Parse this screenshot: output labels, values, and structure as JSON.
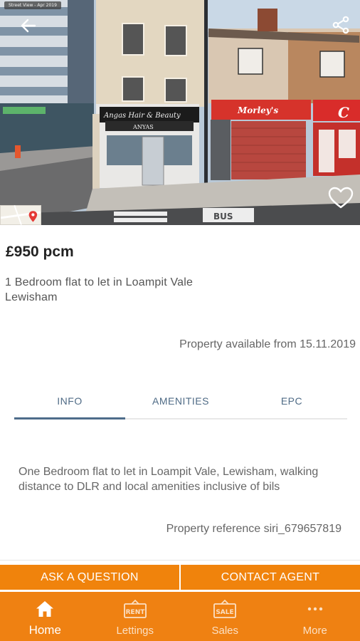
{
  "hero": {
    "streetview_badge": "Street View - Apr 2019",
    "shop_signs": {
      "salon": "Angas Hair & Beauty",
      "salon_name": "ANYAS",
      "takeaway": "Morley's",
      "right_shop": "C"
    },
    "road_marking": "BUS"
  },
  "listing": {
    "price": "£950 pcm",
    "title": "1 Bedroom flat to let in Loampit Vale Lewisham",
    "available": "Property available from 15.11.2019"
  },
  "tabs": [
    {
      "label": "INFO",
      "active": true
    },
    {
      "label": "AMENITIES",
      "active": false
    },
    {
      "label": "EPC",
      "active": false
    }
  ],
  "info": {
    "description": "One Bedroom flat to let in Loampit Vale, Lewisham, walking distance to DLR and local amenities inclusive of bils",
    "reference": "Property reference siri_679657819"
  },
  "actions": {
    "ask": "ASK A QUESTION",
    "contact": "CONTACT AGENT"
  },
  "nav": {
    "items": [
      {
        "label": "Home",
        "icon": "home-icon",
        "badge": ""
      },
      {
        "label": "Lettings",
        "icon": "rent-sign-icon",
        "badge": "RENT"
      },
      {
        "label": "Sales",
        "icon": "sale-sign-icon",
        "badge": "SALE"
      },
      {
        "label": "More",
        "icon": "more-dots-icon",
        "badge": ""
      }
    ]
  },
  "colors": {
    "accent": "#f0830c",
    "nav_bg": "#ef8112",
    "tab_text": "#4f6b86"
  }
}
